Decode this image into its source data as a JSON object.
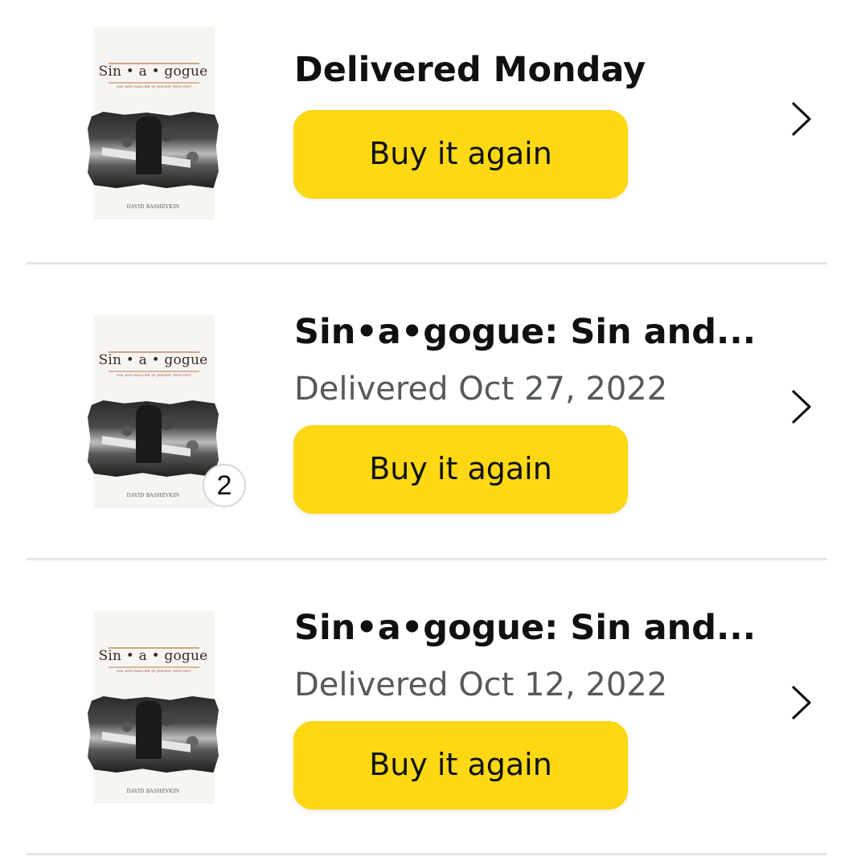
{
  "orders": [
    {
      "title": "Delivered Monday",
      "status": "",
      "button_label": "Buy it again",
      "quantity": null
    },
    {
      "title": "Sin•a•gogue: Sin and...",
      "status": "Delivered Oct 27, 2022",
      "button_label": "Buy it again",
      "quantity": "2"
    },
    {
      "title": "Sin•a•gogue: Sin and...",
      "status": "Delivered Oct 12, 2022",
      "button_label": "Buy it again",
      "quantity": null
    }
  ],
  "cover": {
    "title": "Sin • a • gogue",
    "subtitle": "SIN AND FAILURE IN JEWISH THOUGHT",
    "author": "DAVID BASHEVKIN"
  },
  "icons": {
    "chevron": "chevron-right-icon"
  },
  "colors": {
    "button": "#ffd814",
    "divider": "#e3e6e6",
    "status_text": "#565959"
  }
}
